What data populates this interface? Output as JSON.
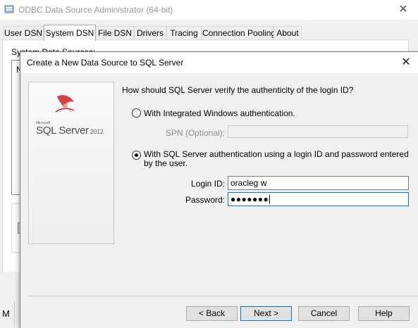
{
  "odbc_window": {
    "title": "ODBC Data Source Administrator (64-bit)",
    "tabs": [
      "User DSN",
      "System DSN",
      "File DSN",
      "Drivers",
      "Tracing",
      "Connection Pooling",
      "About"
    ],
    "active_tab": "System DSN",
    "group_label": "System Data Sources:",
    "list_partial_text": "N",
    "bottom_partial_text": "M"
  },
  "dialog": {
    "title": "Create a New Data Source to SQL Server",
    "brand": {
      "company": "Microsoft",
      "product": "SQL Server",
      "version": "2012"
    },
    "question": "How should SQL Server verify the authenticity of the login ID?",
    "auth_options": [
      {
        "label": "With Integrated Windows authentication.",
        "selected": false
      },
      {
        "label": "With SQL Server authentication using a login ID and password entered by the user.",
        "selected": true
      }
    ],
    "spn": {
      "label": "SPN (Optional):",
      "value": ""
    },
    "login": {
      "label": "Login ID:",
      "value": "oracleg w"
    },
    "password": {
      "label": "Password:",
      "value": "●●●●●●●"
    },
    "buttons": {
      "back": "< Back",
      "next": "Next >",
      "cancel": "Cancel",
      "help": "Help"
    }
  },
  "colors": {
    "focus_border": "#0078d7",
    "disabled_text": "#909090",
    "sql_logo_red": "#cc2027"
  },
  "icons": [
    "odbc-app-icon",
    "close-icon",
    "sql-server-logo-icon"
  ]
}
